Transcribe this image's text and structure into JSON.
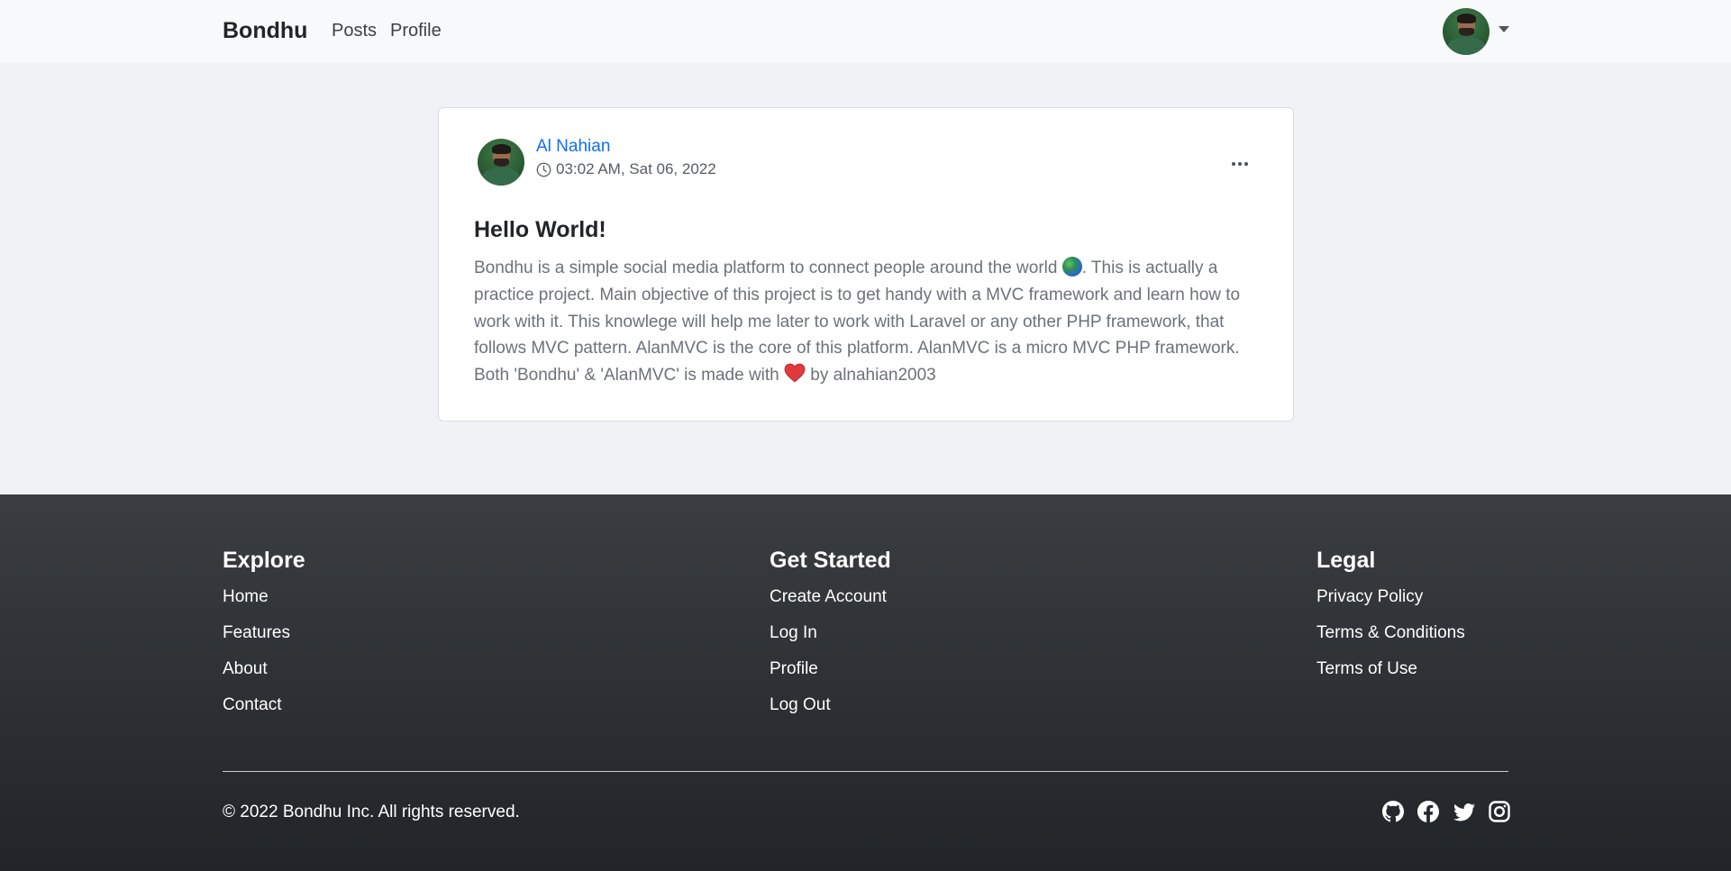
{
  "navbar": {
    "brand": "Bondhu",
    "links": [
      "Posts",
      "Profile"
    ]
  },
  "post": {
    "author": "Al Nahian",
    "timestamp": "03:02 AM, Sat 06, 2022",
    "title": "Hello World!",
    "body_part1": "Bondhu is a simple social media platform to connect people around the world ",
    "body_part2": ". This is actually a practice project. Main objective of this project is to get handy with a MVC framework and learn how to work with it. This knowlege will help me later to work with Laravel or any other PHP framework, that follows MVC pattern. AlanMVC is the core of this platform. AlanMVC is a micro MVC PHP framework. Both 'Bondhu' & 'AlanMVC' is made with ",
    "body_part3": " by alnahian2003",
    "emoji_globe": "globe-icon",
    "emoji_heart": "heart-icon"
  },
  "footer": {
    "columns": [
      {
        "title": "Explore",
        "links": [
          "Home",
          "Features",
          "About",
          "Contact"
        ]
      },
      {
        "title": "Get Started",
        "links": [
          "Create Account",
          "Log In",
          "Profile",
          "Log Out"
        ]
      },
      {
        "title": "Legal",
        "links": [
          "Privacy Policy",
          "Terms & Conditions",
          "Terms of Use"
        ]
      }
    ],
    "copyright": "© 2022 Bondhu Inc. All rights reserved.",
    "social_icons": [
      "github-icon",
      "facebook-icon",
      "twitter-icon",
      "instagram-icon"
    ]
  },
  "colors": {
    "link_blue": "#0d6efd",
    "footer_bg": "#2b2e32",
    "page_bg": "#f0f2f5"
  }
}
